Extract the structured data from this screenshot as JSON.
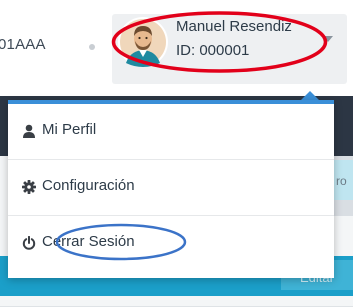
{
  "header": {
    "company_code": "01AAA",
    "user": {
      "name": "Manuel Resendiz",
      "id_label": "ID: 000001"
    }
  },
  "menu": {
    "items": [
      {
        "label": "Mi Perfil",
        "icon": "user-icon"
      },
      {
        "label": "Configuración",
        "icon": "gear-icon"
      },
      {
        "label": "Cerrar Sesión",
        "icon": "power-icon"
      }
    ]
  },
  "background": {
    "partial_text": "ro",
    "edit_button_label": "Editar"
  },
  "colors": {
    "accent": "#3a8fd8",
    "highlight_red": "#e2001a",
    "highlight_blue": "#3b73c8",
    "nav_dark": "#2c3644",
    "teal": "#1b9fc9"
  }
}
